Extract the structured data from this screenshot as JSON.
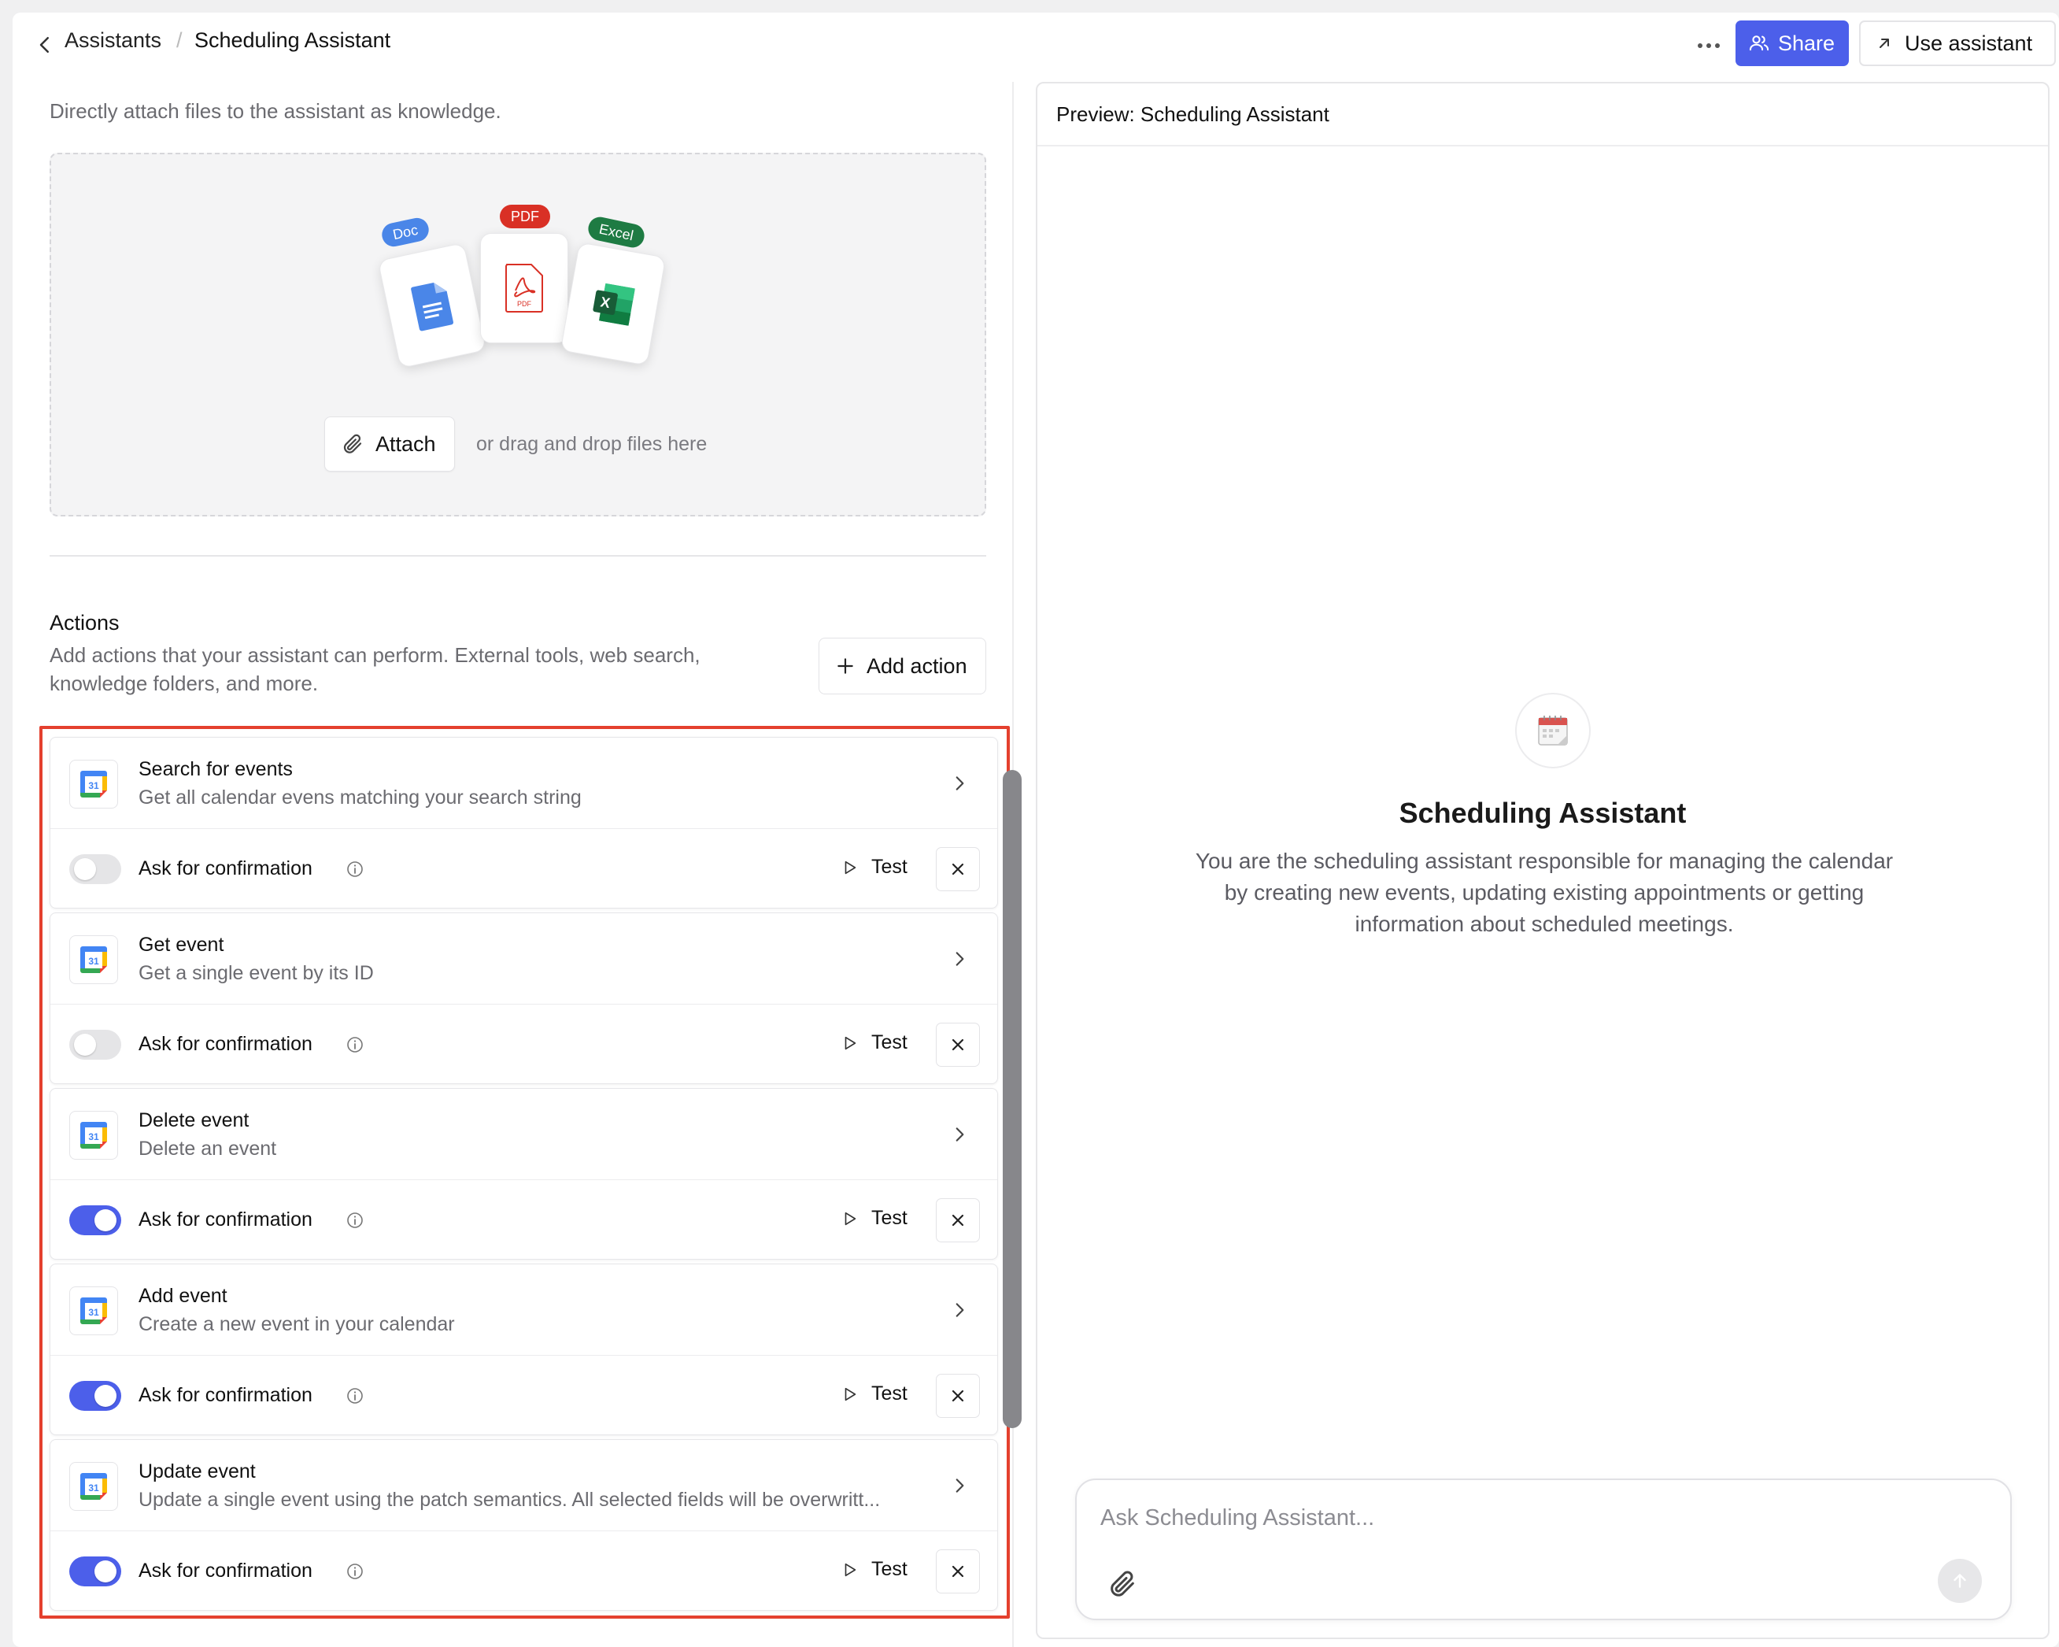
{
  "header": {
    "breadcrumb_root": "Assistants",
    "breadcrumb_separator": "/",
    "breadcrumb_current": "Scheduling Assistant",
    "share_label": "Share",
    "use_label": "Use assistant"
  },
  "knowledge": {
    "description": "Directly attach files to the assistant as knowledge.",
    "file_tags": [
      "Doc",
      "PDF",
      "Excel"
    ],
    "attach_label": "Attach",
    "drag_text": "or drag and drop files here"
  },
  "actions_section": {
    "title": "Actions",
    "description": "Add actions that your assistant can perform. External tools, web search, knowledge folders, and more.",
    "add_label": "Add action",
    "confirm_label": "Ask for confirmation",
    "test_label": "Test",
    "items": [
      {
        "name": "Search for events",
        "desc": "Get all calendar evens matching your search string",
        "confirm": false
      },
      {
        "name": "Get event",
        "desc": "Get a single event by its ID",
        "confirm": false
      },
      {
        "name": "Delete event",
        "desc": "Delete an event",
        "confirm": true
      },
      {
        "name": "Add event",
        "desc": "Create a new event in your calendar",
        "confirm": true
      },
      {
        "name": "Update event",
        "desc": "Update a single event using the patch semantics. All selected fields will be overwritt...",
        "confirm": true
      }
    ]
  },
  "preview": {
    "title": "Preview: Scheduling Assistant",
    "assistant_name": "Scheduling Assistant",
    "assistant_description": "You are the scheduling assistant responsible for managing the calendar by creating new events, updating existing appointments or getting information about scheduled meetings.",
    "input_placeholder": "Ask Scheduling Assistant..."
  },
  "colors": {
    "accent": "#4c5fea",
    "highlight_border": "#e4402e"
  }
}
